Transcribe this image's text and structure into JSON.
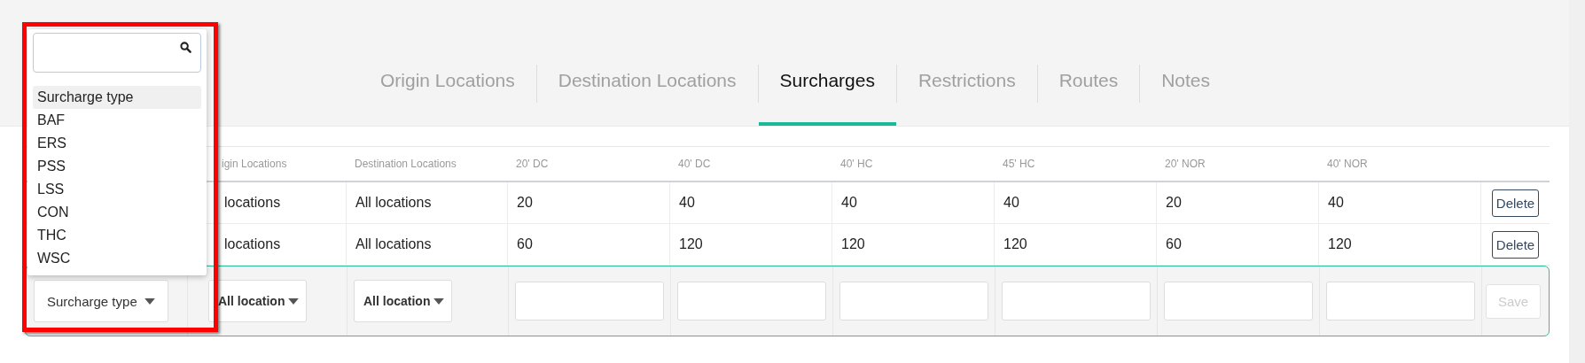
{
  "tabs": [
    {
      "label": "Origin Locations",
      "selected": false
    },
    {
      "label": "Destination Locations",
      "selected": false
    },
    {
      "label": "Surcharges",
      "selected": true
    },
    {
      "label": "Restrictions",
      "selected": false
    },
    {
      "label": "Routes",
      "selected": false
    },
    {
      "label": "Notes",
      "selected": false
    }
  ],
  "table": {
    "columns": [
      "igin Locations",
      "Destination Locations",
      "20' DC",
      "40' DC",
      "40' HC",
      "45' HC",
      "20' NOR",
      "40' NOR"
    ],
    "rows": [
      {
        "cells": [
          "locations",
          "All locations",
          "20",
          "40",
          "40",
          "40",
          "20",
          "40"
        ],
        "action": "Delete"
      },
      {
        "cells": [
          "locations",
          "All locations",
          "60",
          "120",
          "120",
          "120",
          "60",
          "120"
        ],
        "action": "Delete"
      }
    ],
    "new_row": {
      "type_select": "Surcharge type",
      "origin_select": "All location",
      "destination_select": "All location",
      "save": {
        "label": "Save",
        "disabled": true
      }
    }
  },
  "dropdown": {
    "options": [
      {
        "label": "Surcharge type",
        "selected": true
      },
      {
        "label": "BAF",
        "selected": false
      },
      {
        "label": "ERS",
        "selected": false
      },
      {
        "label": "PSS",
        "selected": false
      },
      {
        "label": "LSS",
        "selected": false
      },
      {
        "label": "CON",
        "selected": false
      },
      {
        "label": "THC",
        "selected": false
      },
      {
        "label": "WSC",
        "selected": false
      }
    ]
  }
}
